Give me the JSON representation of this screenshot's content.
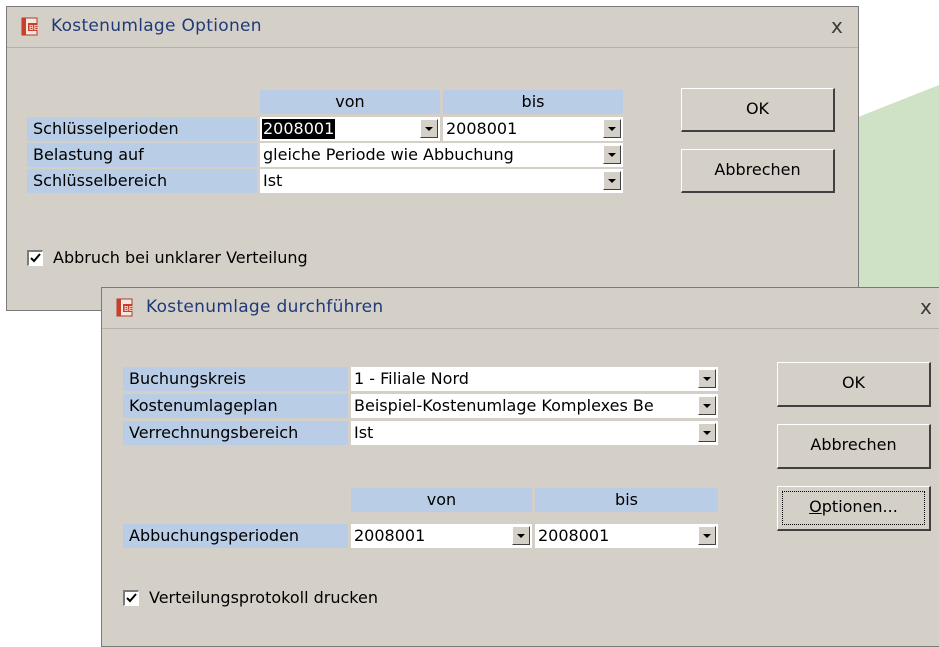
{
  "colors": {
    "dialog_bg": "#d4d0c8",
    "label_bg": "#b9cde6",
    "title_text": "#1f3a78",
    "decor_green": "#cfe2c6"
  },
  "options_dialog": {
    "title": "Kostenumlage Optionen",
    "icon": "app-document-icon",
    "close": "x",
    "headers": {
      "from": "von",
      "to": "bis"
    },
    "rows": {
      "key_periods": {
        "label": "Schlüsselperioden",
        "from_value": "2008001",
        "to_value": "2008001"
      },
      "charge_to": {
        "label": "Belastung auf",
        "value": "gleiche Periode wie Abbuchung"
      },
      "key_area": {
        "label": "Schlüsselbereich",
        "value": "Ist"
      }
    },
    "checkbox": {
      "label": "Abbruch bei unklarer Verteilung",
      "checked": true
    },
    "buttons": {
      "ok": "OK",
      "cancel": "Abbrechen"
    }
  },
  "run_dialog": {
    "title": "Kostenumlage durchführen",
    "icon": "app-document-icon",
    "close": "x",
    "rows": {
      "booking_circle": {
        "label": "Buchungskreis",
        "value": "1 - Filiale Nord"
      },
      "allocation_plan": {
        "label": "Kostenumlageplan",
        "value": "Beispiel-Kostenumlage Komplexes Be"
      },
      "settlement_area": {
        "label": "Verrechnungsbereich",
        "value": "Ist"
      }
    },
    "headers": {
      "from": "von",
      "to": "bis"
    },
    "periods": {
      "label": "Abbuchungsperioden",
      "from_value": "2008001",
      "to_value": "2008001"
    },
    "checkbox": {
      "label": "Verteilungsprotokoll drucken",
      "checked": true
    },
    "buttons": {
      "ok": "OK",
      "cancel": "Abbrechen",
      "options_accel": "O",
      "options_rest": "ptionen..."
    }
  }
}
